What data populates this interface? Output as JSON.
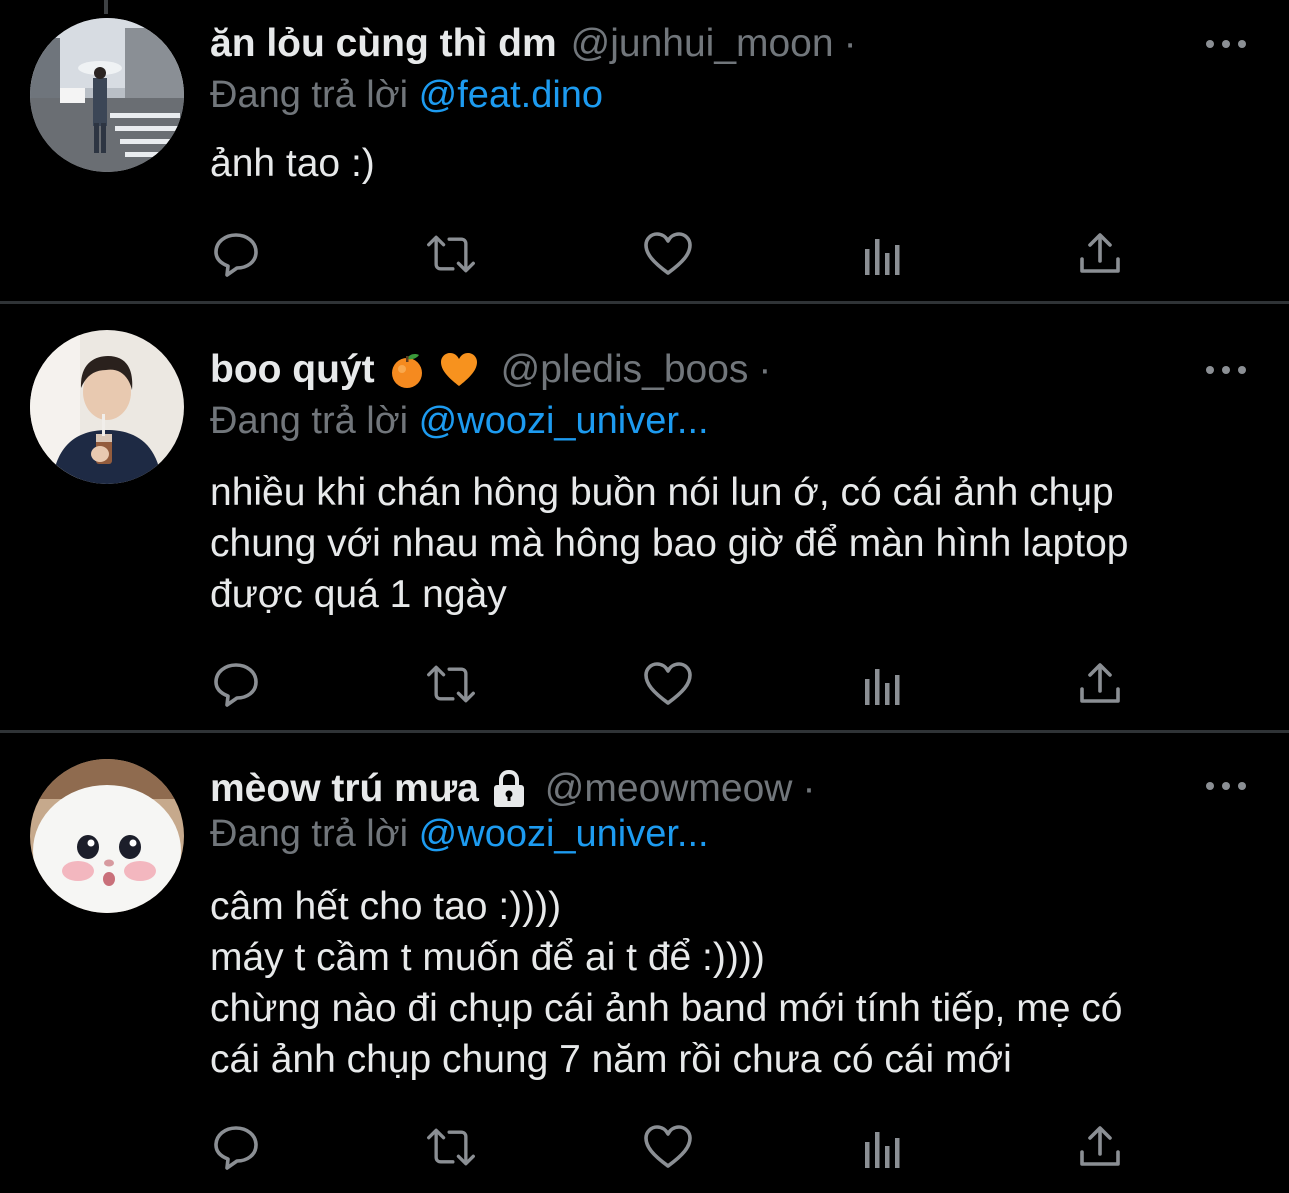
{
  "colors": {
    "background": "#000000",
    "text": "#e7e9ea",
    "muted": "#71767b",
    "link": "#1d9bf0",
    "divider": "#2f3336",
    "icon": "#8b8f94"
  },
  "tweets": [
    {
      "display_name": "ăn lỏu cùng thì dm",
      "handle": "@junhui_moon",
      "separator": "·",
      "reply_prefix": "Đang trả lời",
      "reply_to": "@feat.dino",
      "lines": [
        "ảnh tao :)"
      ],
      "emojis": [],
      "actions": [
        "reply-icon",
        "retweet-icon",
        "like-icon",
        "analytics-icon",
        "share-icon"
      ]
    },
    {
      "display_name": "boo quýt",
      "handle": "@pledis_boos",
      "separator": "·",
      "reply_prefix": "Đang trả lời",
      "reply_to": "@woozi_univer...",
      "lines": [
        "nhiều khi chán hông buồn nói lun ớ, có cái ảnh chụp",
        "chung với nhau mà hông bao giờ để màn hình laptop",
        "được quá 1 ngày"
      ],
      "emojis": [
        "tangerine-emoji",
        "orange-heart-emoji"
      ],
      "actions": [
        "reply-icon",
        "retweet-icon",
        "like-icon",
        "analytics-icon",
        "share-icon"
      ]
    },
    {
      "display_name": "mèow trú mưa",
      "handle": "@meowmeow",
      "separator": "·",
      "reply_prefix": "Đang trả lời",
      "reply_to": "@woozi_univer...",
      "lines": [
        "câm hết cho tao :))))",
        "máy t cầm t muốn để ai t để :))))",
        "chừng nào đi chụp cái ảnh band mới tính tiếp, mẹ có",
        "cái ảnh chụp chung 7 năm rồi chưa có cái mới"
      ],
      "emojis": [
        "lock-icon"
      ],
      "actions": [
        "reply-icon",
        "retweet-icon",
        "like-icon",
        "analytics-icon",
        "share-icon"
      ]
    }
  ]
}
